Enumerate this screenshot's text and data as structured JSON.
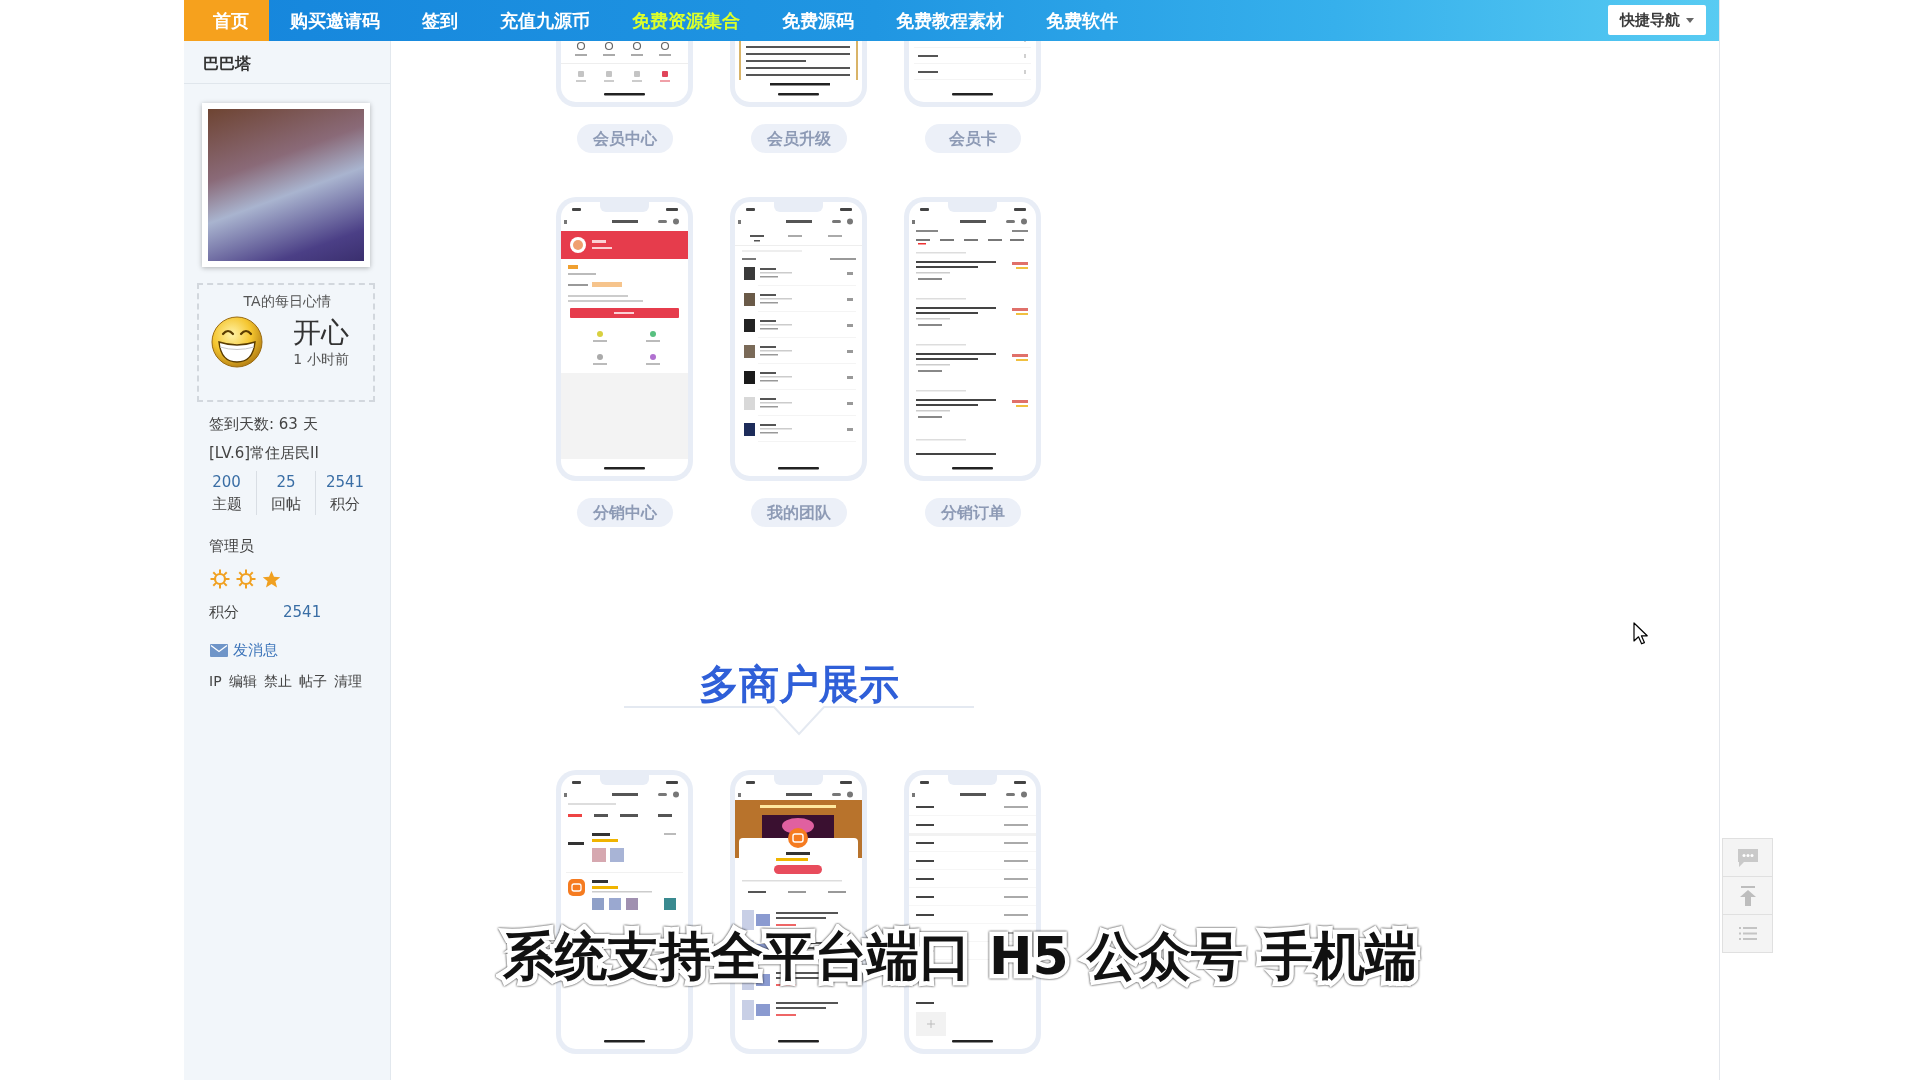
{
  "nav": {
    "items": [
      {
        "label": "首页",
        "selected": true,
        "highlighted": false
      },
      {
        "label": "购买邀请码",
        "selected": false,
        "highlighted": false
      },
      {
        "label": "签到",
        "selected": false,
        "highlighted": false
      },
      {
        "label": "充值九源币",
        "selected": false,
        "highlighted": false
      },
      {
        "label": "免费资源集合",
        "selected": false,
        "highlighted": true
      },
      {
        "label": "免费源码",
        "selected": false,
        "highlighted": false
      },
      {
        "label": "免费教程素材",
        "selected": false,
        "highlighted": false
      },
      {
        "label": "免费软件",
        "selected": false,
        "highlighted": false
      }
    ],
    "quick_nav": "快捷导航"
  },
  "profile": {
    "username": "巴巴塔",
    "mood": {
      "title": "TA的每日心情",
      "feeling": "开心",
      "time": "1 小时前"
    },
    "checkin_days": "签到天数: 63 天",
    "level": "[LV.6]常住居民II",
    "stats": [
      {
        "value": "200",
        "label": "主题"
      },
      {
        "value": "25",
        "label": "回帖"
      },
      {
        "value": "2541",
        "label": "积分"
      }
    ],
    "group": "管理员",
    "rank_icons": [
      {
        "kind": "sun"
      },
      {
        "kind": "sun"
      },
      {
        "kind": "star"
      }
    ],
    "points": {
      "label": "积分",
      "value": "2541"
    },
    "message_link": "发消息",
    "admin_links": [
      "IP",
      "编辑",
      "禁止",
      "帖子",
      "清理"
    ]
  },
  "post": {
    "screen_rows": [
      {
        "cropped": true,
        "screens": [
          {
            "kind": "iconbar",
            "label": "会员中心"
          },
          {
            "kind": "article",
            "label": "会员升级"
          },
          {
            "kind": "settings",
            "label": "会员卡"
          }
        ]
      },
      {
        "cropped": false,
        "screens": [
          {
            "kind": "wallet",
            "label": "分销中心"
          },
          {
            "kind": "team",
            "label": "我的团队"
          },
          {
            "kind": "orders",
            "label": "分销订单"
          }
        ]
      }
    ],
    "section_title": "多商户展示",
    "section_screens": [
      {
        "kind": "shops"
      },
      {
        "kind": "store"
      },
      {
        "kind": "form"
      }
    ]
  },
  "caption": "系统支持全平台端口 H5 公众号 手机端"
}
